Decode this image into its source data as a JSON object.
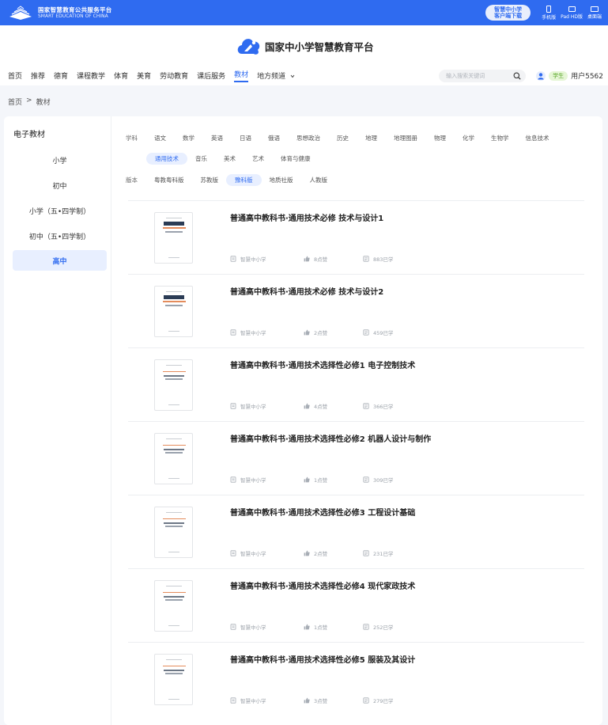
{
  "topbar": {
    "brand_cn": "国家智慧教育公共服务平台",
    "brand_en": "SMART EDUCATION OF CHINA",
    "download_line1": "智慧中小学",
    "download_line2": "客户端下载",
    "devices": [
      "手机版",
      "Pad HD版",
      "桌面端"
    ]
  },
  "header": {
    "site_title": "国家中小学智慧教育平台",
    "nav": [
      "首页",
      "推荐",
      "德育",
      "课程教学",
      "体育",
      "美育",
      "劳动教育",
      "课后服务",
      "教材",
      "地方频道"
    ],
    "nav_active": "教材",
    "search_placeholder": "输入搜索关键词",
    "role": "学生",
    "username": "用户5562"
  },
  "breadcrumb": {
    "home": "首页",
    "separator": ">",
    "current": "教材"
  },
  "sidebar": {
    "title": "电子教材",
    "items": [
      "小学",
      "初中",
      "小学（五•四学制）",
      "初中（五•四学制）",
      "高中"
    ],
    "active": "高中"
  },
  "filters": {
    "subject_label": "学科",
    "subjects_row1": [
      "语文",
      "数学",
      "英语",
      "日语",
      "俄语",
      "思想政治",
      "历史",
      "地理",
      "地理图册",
      "物理",
      "化学",
      "生物学",
      "信息技术"
    ],
    "subjects_row2": [
      "通用技术",
      "音乐",
      "美术",
      "艺术",
      "体育与健康"
    ],
    "subject_selected": "通用技术",
    "edition_label": "版本",
    "editions": [
      "粤教粤科版",
      "苏教版",
      "豫科版",
      "地质社版",
      "人教版"
    ],
    "edition_selected": "豫科版"
  },
  "books": [
    {
      "title": "普通高中教科书·通用技术必修 技术与设计1",
      "publisher": "智慧中小学",
      "likes": "8点赞",
      "learners": "883已学"
    },
    {
      "title": "普通高中教科书·通用技术必修 技术与设计2",
      "publisher": "智慧中小学",
      "likes": "2点赞",
      "learners": "459已学"
    },
    {
      "title": "普通高中教科书·通用技术选择性必修1 电子控制技术",
      "publisher": "智慧中小学",
      "likes": "4点赞",
      "learners": "366已学"
    },
    {
      "title": "普通高中教科书·通用技术选择性必修2 机器人设计与制作",
      "publisher": "智慧中小学",
      "likes": "1点赞",
      "learners": "309已学"
    },
    {
      "title": "普通高中教科书·通用技术选择性必修3 工程设计基础",
      "publisher": "智慧中小学",
      "likes": "2点赞",
      "learners": "231已学"
    },
    {
      "title": "普通高中教科书·通用技术选择性必修4 现代家政技术",
      "publisher": "智慧中小学",
      "likes": "1点赞",
      "learners": "252已学"
    },
    {
      "title": "普通高中教科书·通用技术选择性必修5 服装及其设计",
      "publisher": "智慧中小学",
      "likes": "3点赞",
      "learners": "279已学"
    }
  ],
  "colors": {
    "brand_blue": "#2f6bf0",
    "selected_bg": "#e8efff",
    "role_green": "#5aa82a"
  },
  "icons": [
    "books-logo-icon",
    "cloud-logo-icon",
    "phone-icon",
    "tablet-icon",
    "desktop-icon",
    "search-icon",
    "user-avatar-icon",
    "chevron-down-icon",
    "publisher-icon",
    "thumb-up-icon",
    "learned-icon"
  ]
}
